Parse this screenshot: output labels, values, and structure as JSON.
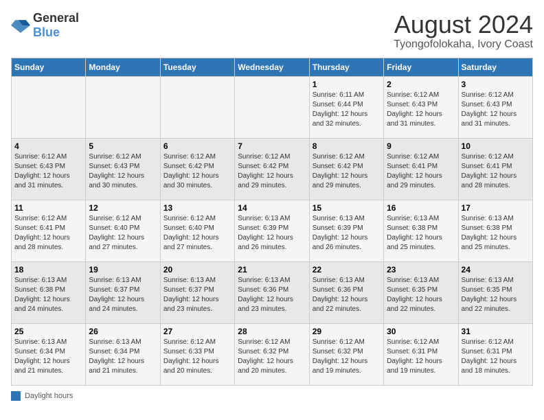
{
  "header": {
    "logo_general": "General",
    "logo_blue": "Blue",
    "title": "August 2024",
    "subtitle": "Tyongofolokaha, Ivory Coast"
  },
  "legend": {
    "text": "Daylight hours"
  },
  "days_of_week": [
    "Sunday",
    "Monday",
    "Tuesday",
    "Wednesday",
    "Thursday",
    "Friday",
    "Saturday"
  ],
  "weeks": [
    [
      {
        "day": "",
        "info": ""
      },
      {
        "day": "",
        "info": ""
      },
      {
        "day": "",
        "info": ""
      },
      {
        "day": "",
        "info": ""
      },
      {
        "day": "1",
        "info": "Sunrise: 6:11 AM\nSunset: 6:44 PM\nDaylight: 12 hours\nand 32 minutes."
      },
      {
        "day": "2",
        "info": "Sunrise: 6:12 AM\nSunset: 6:43 PM\nDaylight: 12 hours\nand 31 minutes."
      },
      {
        "day": "3",
        "info": "Sunrise: 6:12 AM\nSunset: 6:43 PM\nDaylight: 12 hours\nand 31 minutes."
      }
    ],
    [
      {
        "day": "4",
        "info": "Sunrise: 6:12 AM\nSunset: 6:43 PM\nDaylight: 12 hours\nand 31 minutes."
      },
      {
        "day": "5",
        "info": "Sunrise: 6:12 AM\nSunset: 6:43 PM\nDaylight: 12 hours\nand 30 minutes."
      },
      {
        "day": "6",
        "info": "Sunrise: 6:12 AM\nSunset: 6:42 PM\nDaylight: 12 hours\nand 30 minutes."
      },
      {
        "day": "7",
        "info": "Sunrise: 6:12 AM\nSunset: 6:42 PM\nDaylight: 12 hours\nand 29 minutes."
      },
      {
        "day": "8",
        "info": "Sunrise: 6:12 AM\nSunset: 6:42 PM\nDaylight: 12 hours\nand 29 minutes."
      },
      {
        "day": "9",
        "info": "Sunrise: 6:12 AM\nSunset: 6:41 PM\nDaylight: 12 hours\nand 29 minutes."
      },
      {
        "day": "10",
        "info": "Sunrise: 6:12 AM\nSunset: 6:41 PM\nDaylight: 12 hours\nand 28 minutes."
      }
    ],
    [
      {
        "day": "11",
        "info": "Sunrise: 6:12 AM\nSunset: 6:41 PM\nDaylight: 12 hours\nand 28 minutes."
      },
      {
        "day": "12",
        "info": "Sunrise: 6:12 AM\nSunset: 6:40 PM\nDaylight: 12 hours\nand 27 minutes."
      },
      {
        "day": "13",
        "info": "Sunrise: 6:12 AM\nSunset: 6:40 PM\nDaylight: 12 hours\nand 27 minutes."
      },
      {
        "day": "14",
        "info": "Sunrise: 6:13 AM\nSunset: 6:39 PM\nDaylight: 12 hours\nand 26 minutes."
      },
      {
        "day": "15",
        "info": "Sunrise: 6:13 AM\nSunset: 6:39 PM\nDaylight: 12 hours\nand 26 minutes."
      },
      {
        "day": "16",
        "info": "Sunrise: 6:13 AM\nSunset: 6:38 PM\nDaylight: 12 hours\nand 25 minutes."
      },
      {
        "day": "17",
        "info": "Sunrise: 6:13 AM\nSunset: 6:38 PM\nDaylight: 12 hours\nand 25 minutes."
      }
    ],
    [
      {
        "day": "18",
        "info": "Sunrise: 6:13 AM\nSunset: 6:38 PM\nDaylight: 12 hours\nand 24 minutes."
      },
      {
        "day": "19",
        "info": "Sunrise: 6:13 AM\nSunset: 6:37 PM\nDaylight: 12 hours\nand 24 minutes."
      },
      {
        "day": "20",
        "info": "Sunrise: 6:13 AM\nSunset: 6:37 PM\nDaylight: 12 hours\nand 23 minutes."
      },
      {
        "day": "21",
        "info": "Sunrise: 6:13 AM\nSunset: 6:36 PM\nDaylight: 12 hours\nand 23 minutes."
      },
      {
        "day": "22",
        "info": "Sunrise: 6:13 AM\nSunset: 6:36 PM\nDaylight: 12 hours\nand 22 minutes."
      },
      {
        "day": "23",
        "info": "Sunrise: 6:13 AM\nSunset: 6:35 PM\nDaylight: 12 hours\nand 22 minutes."
      },
      {
        "day": "24",
        "info": "Sunrise: 6:13 AM\nSunset: 6:35 PM\nDaylight: 12 hours\nand 22 minutes."
      }
    ],
    [
      {
        "day": "25",
        "info": "Sunrise: 6:13 AM\nSunset: 6:34 PM\nDaylight: 12 hours\nand 21 minutes."
      },
      {
        "day": "26",
        "info": "Sunrise: 6:13 AM\nSunset: 6:34 PM\nDaylight: 12 hours\nand 21 minutes."
      },
      {
        "day": "27",
        "info": "Sunrise: 6:12 AM\nSunset: 6:33 PM\nDaylight: 12 hours\nand 20 minutes."
      },
      {
        "day": "28",
        "info": "Sunrise: 6:12 AM\nSunset: 6:32 PM\nDaylight: 12 hours\nand 20 minutes."
      },
      {
        "day": "29",
        "info": "Sunrise: 6:12 AM\nSunset: 6:32 PM\nDaylight: 12 hours\nand 19 minutes."
      },
      {
        "day": "30",
        "info": "Sunrise: 6:12 AM\nSunset: 6:31 PM\nDaylight: 12 hours\nand 19 minutes."
      },
      {
        "day": "31",
        "info": "Sunrise: 6:12 AM\nSunset: 6:31 PM\nDaylight: 12 hours\nand 18 minutes."
      }
    ]
  ]
}
